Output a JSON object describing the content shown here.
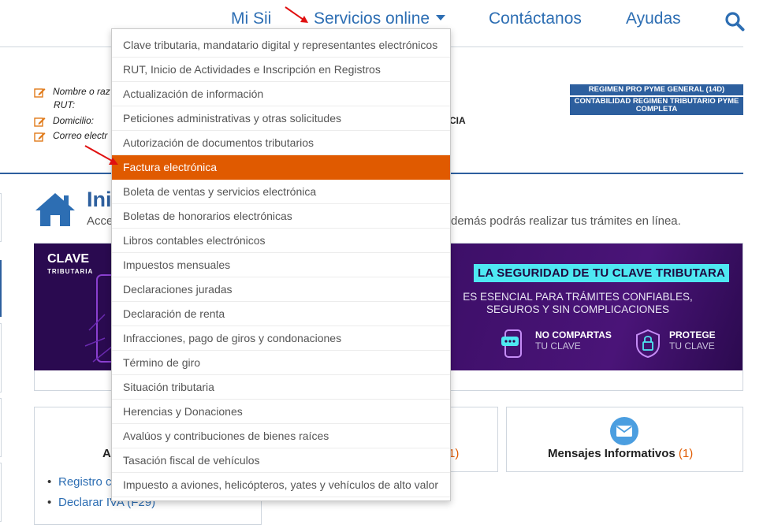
{
  "nav": {
    "mi_sii": "Mi Sii",
    "servicios": "Servicios online",
    "contactanos": "Contáctanos",
    "ayudas": "Ayudas"
  },
  "taxpayer": {
    "name_label": "Nombre o raz",
    "rut_label": "RUT:",
    "domicilio_label": "Domicilio:",
    "correo_label": "Correo electr",
    "domicilio_tail": "CIA",
    "regime_1": "REGIMEN PRO PYME GENERAL (14D)",
    "regime_2": "CONTABILIDAD REGIMEN TRIBUTARIO PYME COMPLETA"
  },
  "hero": {
    "title": "Ini",
    "desc": "Acce",
    "desc_tail": "demás podrás realizar tus trámites en línea."
  },
  "banner": {
    "logo": "CLAVE",
    "logo_sub": "TRIBUTARIA",
    "title": "LA SEGURIDAD DE TU CLAVE TRIBUTARA",
    "sub_1": "ES ESENCIAL PARA TRÁMITES CONFIABLES,",
    "sub_2": "SEGUROS Y SIN COMPLICACIONES",
    "badge_1_bold": "NO COMPARTAS",
    "badge_1_sub": "TU CLAVE",
    "badge_2_bold": "PROTEGE",
    "badge_2_sub": "TU CLAVE"
  },
  "cards": {
    "left_heading": "A",
    "left_links": [
      "Registro c",
      "Declarar IVA (F29)"
    ],
    "mid_count": "1)",
    "right_heading": "Mensajes Informativos",
    "right_count": "(1)"
  },
  "dropdown": {
    "items": [
      "Clave tributaria, mandatario digital y representantes electrónicos",
      "RUT, Inicio de Actividades e Inscripción en Registros",
      "Actualización de información",
      "Peticiones administrativas y otras solicitudes",
      "Autorización de documentos tributarios",
      "Factura electrónica",
      "Boleta de ventas y servicios electrónica",
      "Boletas de honorarios electrónicas",
      "Libros contables electrónicos",
      "Impuestos mensuales",
      "Declaraciones juradas",
      "Declaración de renta",
      "Infracciones, pago de giros y condonaciones",
      "Término de giro",
      "Situación tributaria",
      "Herencias y Donaciones",
      "Avalúos y contribuciones de bienes raíces",
      "Tasación fiscal de vehículos",
      "Impuesto a aviones, helicópteros, yates y vehículos de alto valor"
    ],
    "active_index": 5
  },
  "colors": {
    "nav_blue": "#2d6eb3",
    "dark_blue": "#2d5f9e",
    "active_orange": "#e05a00",
    "banner_purple": "#2a0a50",
    "banner_cyan": "#4ee8f2"
  },
  "icons": [
    "search-icon",
    "home-icon",
    "edit-icon",
    "mail-icon",
    "shield-icon",
    "phone-icon"
  ]
}
